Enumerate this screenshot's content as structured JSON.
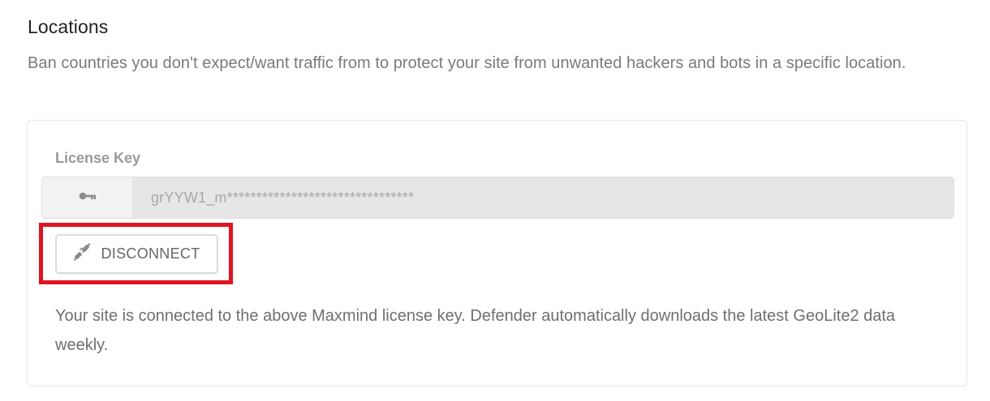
{
  "section": {
    "title": "Locations",
    "description": "Ban countries you don't expect/want traffic from to protect your site from unwanted hackers and bots in a specific location."
  },
  "license": {
    "label": "License Key",
    "value": "grYYW1_m********************************",
    "icon": "key-icon"
  },
  "disconnect_button": {
    "label": "DISCONNECT",
    "icon": "unplug-icon"
  },
  "info": {
    "text": "Your site is connected to the above Maxmind license key. Defender automatically downloads the latest GeoLite2 data weekly."
  },
  "colors": {
    "highlight": "#e0141e",
    "title": "#222222",
    "muted_text": "#7a7a7a",
    "field_background": "#e6e6e6"
  }
}
